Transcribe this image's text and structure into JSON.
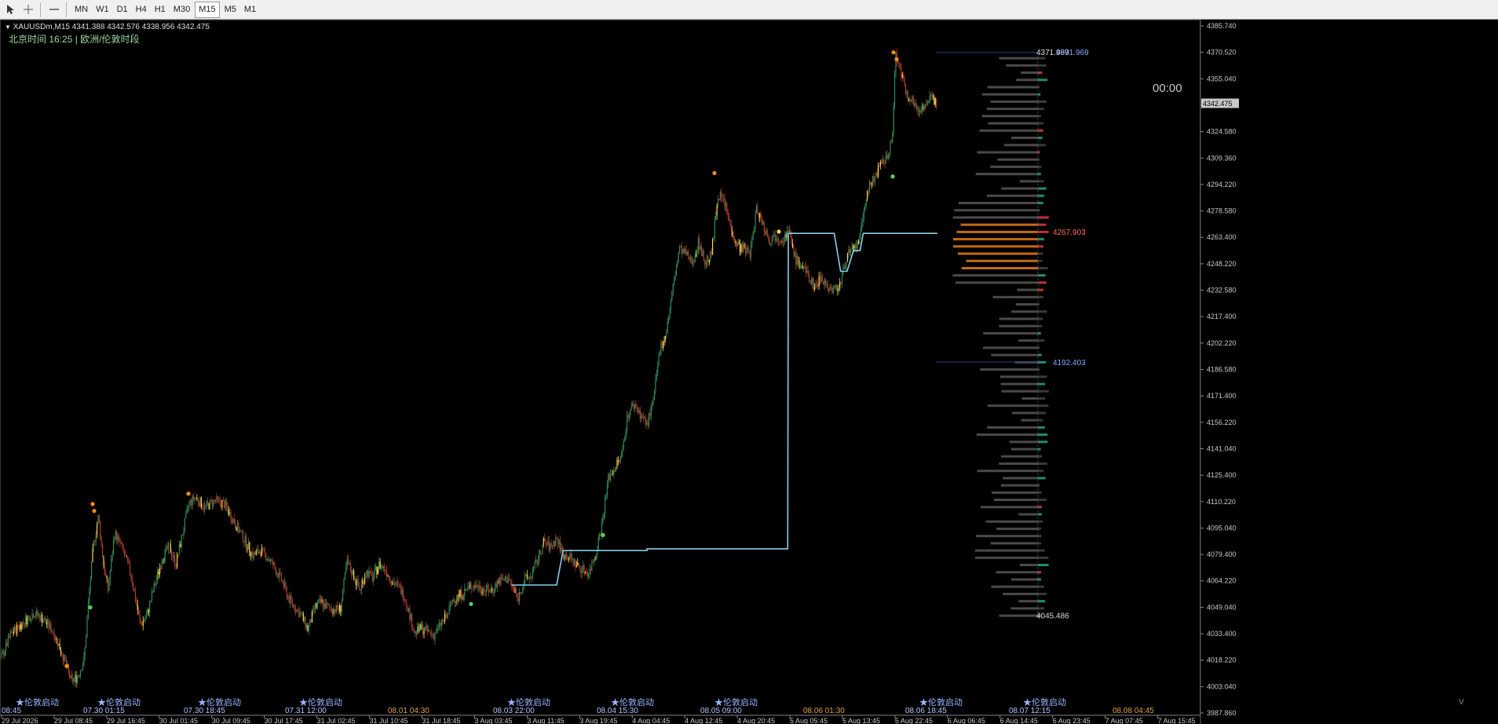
{
  "toolbar": {
    "timeframes": [
      {
        "label": "MN",
        "active": false
      },
      {
        "label": "W1",
        "active": false
      },
      {
        "label": "D1",
        "active": false
      },
      {
        "label": "H4",
        "active": false
      },
      {
        "label": "H1",
        "active": false
      },
      {
        "label": "M30",
        "active": false
      },
      {
        "label": "M15",
        "active": true
      },
      {
        "label": "M5",
        "active": false
      },
      {
        "label": "M1",
        "active": false
      }
    ]
  },
  "chart": {
    "symbol_info": "XAUUSDm,M15  4341.388 4342.576 4338.956 4342.475",
    "session_text": "北京时间 16:25 | 欧洲/伦敦时段",
    "countdown": "00:00",
    "current_price": "4342.475",
    "corner_letter": "V",
    "colors": {
      "bg": "#000000",
      "bull": "#26a69a",
      "bear": "#ef5350",
      "poc": "#ff8c00",
      "vwap": "#87ceeb",
      "level_line": "#2a3a8c"
    },
    "price_axis": {
      "min": 3987.86,
      "max": 4391.0,
      "ticks": [
        "4385.740",
        "4370.520",
        "4355.040",
        "4339.820",
        "4324.580",
        "4309.360",
        "4294.220",
        "4278.580",
        "4263.400",
        "4248.220",
        "4232.580",
        "4217.400",
        "4202.220",
        "4186.580",
        "4171.400",
        "4156.220",
        "4141.040",
        "4125.400",
        "4110.220",
        "4095.040",
        "4079.400",
        "4064.220",
        "4049.040",
        "4033.400",
        "4018.220",
        "4003.040",
        "3987.860"
      ]
    },
    "time_axis": {
      "labels": [
        "29 Jul 2026",
        "29 Jul 08:45",
        "29 Jul 16:45",
        "30 Jul 01:45",
        "30 Jul 09:45",
        "30 Jul 17:45",
        "31 Jul 02:45",
        "31 Jul 10:45",
        "31 Jul 18:45",
        "3 Aug 03:45",
        "3 Aug 11:45",
        "3 Aug 19:45",
        "4 Aug 04:45",
        "4 Aug 12:45",
        "4 Aug 20:45",
        "5 Aug 05:45",
        "5 Aug 13:45",
        "5 Aug 22:45",
        "6 Aug 06:45",
        "6 Aug 14:45",
        "6 Aug 23:45",
        "7 Aug 07:45",
        "7 Aug 15:45"
      ]
    },
    "session_markers": [
      {
        "star": "★伦敦启动",
        "time": "08:45"
      },
      {
        "star": "★伦敦启动",
        "time": "07.30 01:15"
      },
      {
        "star": "★伦敦启动",
        "time": "07.30 18:45"
      },
      {
        "star": "★伦敦启动",
        "time": "07.31 12:00"
      },
      {
        "star": "",
        "time": "08.01 04:30"
      },
      {
        "star": "★伦敦启动",
        "time": "08.03 22:00"
      },
      {
        "star": "★伦敦启动",
        "time": "08.04 15:30"
      },
      {
        "star": "★伦敦启动",
        "time": "08.05 09:00"
      },
      {
        "star": "",
        "time": "08.06 01:30"
      },
      {
        "star": "★伦敦启动",
        "time": "08.06 18:45"
      },
      {
        "star": "★伦敦启动",
        "time": "08.07 12:15"
      },
      {
        "star": "",
        "time": "08.08 04:45"
      }
    ],
    "volume_profile": {
      "high_label": "4371.969",
      "high_label_overlap": "4371.969",
      "poc_label": "4267.903",
      "value_low_label": "4192.403",
      "low_label": "4045.486"
    },
    "price_path": [
      [
        0,
        4021
      ],
      [
        15,
        4035
      ],
      [
        30,
        4040
      ],
      [
        50,
        4047
      ],
      [
        65,
        4043
      ],
      [
        80,
        4036
      ],
      [
        95,
        4022
      ],
      [
        108,
        4007
      ],
      [
        118,
        4010
      ],
      [
        128,
        4020
      ],
      [
        135,
        4055
      ],
      [
        142,
        4085
      ],
      [
        150,
        4103
      ],
      [
        158,
        4075
      ],
      [
        165,
        4060
      ],
      [
        175,
        4093
      ],
      [
        185,
        4086
      ],
      [
        200,
        4070
      ],
      [
        215,
        4040
      ],
      [
        225,
        4045
      ],
      [
        235,
        4060
      ],
      [
        250,
        4080
      ],
      [
        260,
        4085
      ],
      [
        270,
        4075
      ],
      [
        280,
        4092
      ],
      [
        290,
        4110
      ],
      [
        300,
        4114
      ],
      [
        315,
        4108
      ],
      [
        330,
        4112
      ],
      [
        345,
        4110
      ],
      [
        360,
        4100
      ],
      [
        375,
        4090
      ],
      [
        390,
        4080
      ],
      [
        400,
        4083
      ],
      [
        410,
        4080
      ],
      [
        420,
        4075
      ],
      [
        435,
        4065
      ],
      [
        445,
        4055
      ],
      [
        455,
        4050
      ],
      [
        465,
        4045
      ],
      [
        475,
        4037
      ],
      [
        485,
        4050
      ],
      [
        495,
        4053
      ],
      [
        505,
        4050
      ],
      [
        515,
        4049
      ],
      [
        525,
        4049
      ],
      [
        535,
        4076
      ],
      [
        545,
        4069
      ],
      [
        555,
        4060
      ],
      [
        565,
        4071
      ],
      [
        575,
        4067
      ],
      [
        585,
        4075
      ],
      [
        595,
        4072
      ],
      [
        605,
        4065
      ],
      [
        615,
        4062
      ],
      [
        625,
        4056
      ],
      [
        640,
        4035
      ],
      [
        650,
        4038
      ],
      [
        660,
        4036
      ],
      [
        670,
        4034
      ],
      [
        680,
        4040
      ],
      [
        690,
        4045
      ],
      [
        700,
        4055
      ],
      [
        710,
        4057
      ],
      [
        720,
        4060
      ],
      [
        730,
        4063
      ],
      [
        740,
        4062
      ],
      [
        750,
        4060
      ],
      [
        760,
        4060
      ],
      [
        770,
        4065
      ],
      [
        785,
        4067
      ],
      [
        800,
        4055
      ],
      [
        810,
        4066
      ],
      [
        820,
        4068
      ],
      [
        830,
        4077
      ],
      [
        840,
        4088
      ],
      [
        850,
        4085
      ],
      [
        860,
        4090
      ],
      [
        870,
        4081
      ],
      [
        880,
        4079
      ],
      [
        890,
        4075
      ],
      [
        900,
        4072
      ],
      [
        910,
        4070
      ],
      [
        920,
        4081
      ],
      [
        930,
        4098
      ],
      [
        940,
        4125
      ],
      [
        950,
        4131
      ],
      [
        960,
        4137
      ],
      [
        970,
        4162
      ],
      [
        980,
        4168
      ],
      [
        990,
        4162
      ],
      [
        1000,
        4156
      ],
      [
        1010,
        4170
      ],
      [
        1020,
        4200
      ],
      [
        1030,
        4210
      ],
      [
        1040,
        4235
      ],
      [
        1050,
        4258
      ],
      [
        1060,
        4255
      ],
      [
        1070,
        4250
      ],
      [
        1080,
        4262
      ],
      [
        1090,
        4250
      ],
      [
        1100,
        4255
      ],
      [
        1110,
        4290
      ],
      [
        1120,
        4285
      ],
      [
        1130,
        4270
      ],
      [
        1140,
        4260
      ],
      [
        1150,
        4258
      ],
      [
        1160,
        4256
      ],
      [
        1170,
        4282
      ],
      [
        1180,
        4272
      ],
      [
        1190,
        4263
      ],
      [
        1200,
        4266
      ],
      [
        1210,
        4264
      ],
      [
        1220,
        4268
      ],
      [
        1230,
        4252
      ],
      [
        1240,
        4248
      ],
      [
        1250,
        4242
      ],
      [
        1260,
        4236
      ],
      [
        1270,
        4242
      ],
      [
        1280,
        4236
      ],
      [
        1290,
        4234
      ],
      [
        1300,
        4238
      ],
      [
        1310,
        4255
      ],
      [
        1320,
        4257
      ],
      [
        1330,
        4264
      ],
      [
        1340,
        4290
      ],
      [
        1350,
        4298
      ],
      [
        1360,
        4305
      ],
      [
        1370,
        4310
      ],
      [
        1380,
        4321
      ],
      [
        1385,
        4371
      ],
      [
        1390,
        4366
      ],
      [
        1400,
        4350
      ],
      [
        1410,
        4345
      ],
      [
        1420,
        4338
      ],
      [
        1430,
        4342
      ],
      [
        1440,
        4345
      ],
      [
        1450,
        4342
      ]
    ],
    "vwap_path": [
      [
        790,
        4063
      ],
      [
        860,
        4063
      ],
      [
        870,
        4083
      ],
      [
        1000,
        4083
      ],
      [
        1000,
        4084
      ],
      [
        1218,
        4084
      ],
      [
        1219,
        4267
      ],
      [
        1290,
        4267
      ],
      [
        1300,
        4245
      ],
      [
        1310,
        4245
      ],
      [
        1320,
        4257
      ],
      [
        1330,
        4257
      ],
      [
        1335,
        4267
      ],
      [
        1450,
        4267
      ]
    ]
  }
}
